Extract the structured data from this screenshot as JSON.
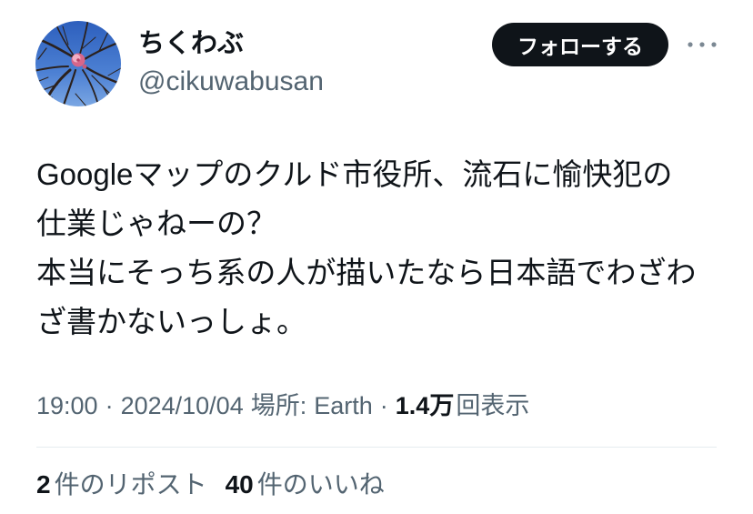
{
  "author": {
    "display_name": "ちくわぶ",
    "handle": "@cikuwabusan"
  },
  "follow_button": {
    "label": "フォローする"
  },
  "more_menu": {
    "icon": "more-horizontal-icon"
  },
  "tweet": {
    "body_lines": [
      "Googleマップのクルド市役所、流石に愉快犯の",
      "仕業じゃねーの？",
      "本当にそっち系の人が描いたなら日本語でわざわ",
      "ざ書かないっしょ。"
    ]
  },
  "meta": {
    "time": "19:00",
    "separator": "·",
    "date": "2024/10/04",
    "location_label": "場所:",
    "location": "Earth",
    "views_count": "1.4万",
    "views_label": "回表示"
  },
  "stats": {
    "reposts_count": "2",
    "reposts_label": "件のリポスト",
    "likes_count": "40",
    "likes_label": "件のいいね"
  },
  "colors": {
    "primary_text": "#0f1419",
    "secondary_text": "#536471",
    "follow_button_bg": "#0f1419",
    "follow_button_text": "#ffffff",
    "divider": "#e6ecf0"
  }
}
